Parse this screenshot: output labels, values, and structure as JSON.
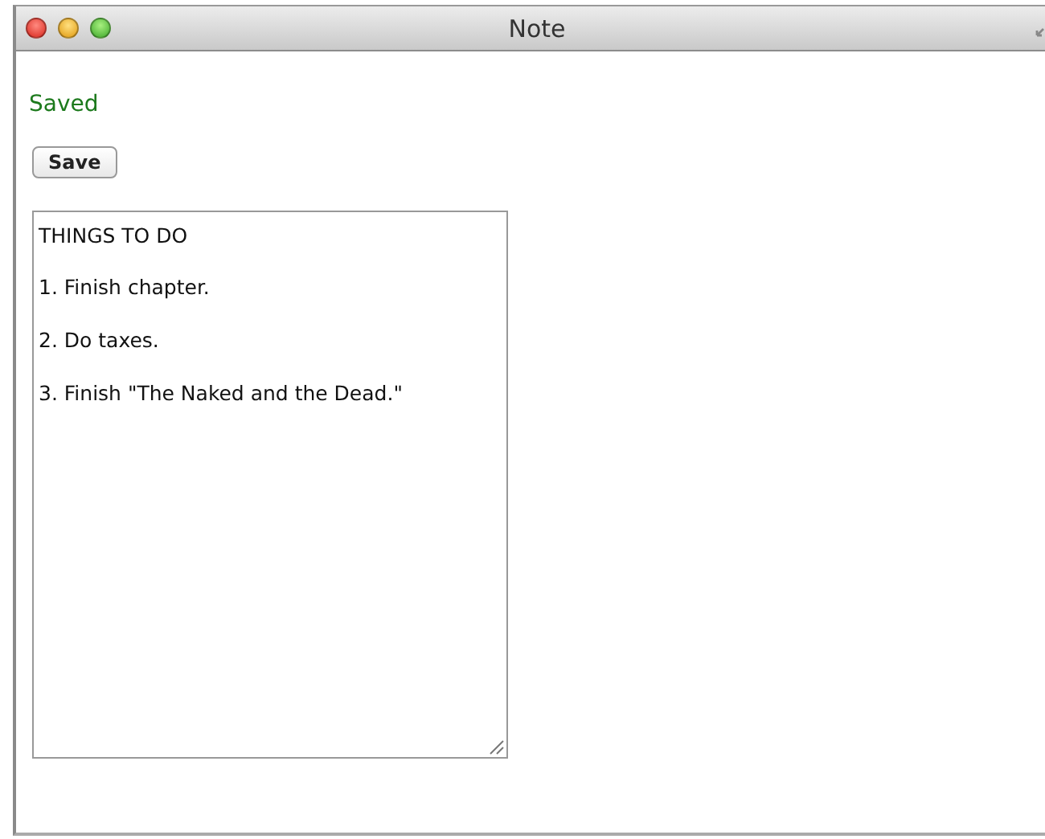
{
  "window": {
    "title": "Note"
  },
  "status": "Saved",
  "save_button": "Save",
  "note": {
    "lines": [
      "THINGS TO DO",
      "1. Finish chapter.",
      "2. Do taxes.",
      "3. Finish \"The Naked and the Dead.\""
    ]
  }
}
